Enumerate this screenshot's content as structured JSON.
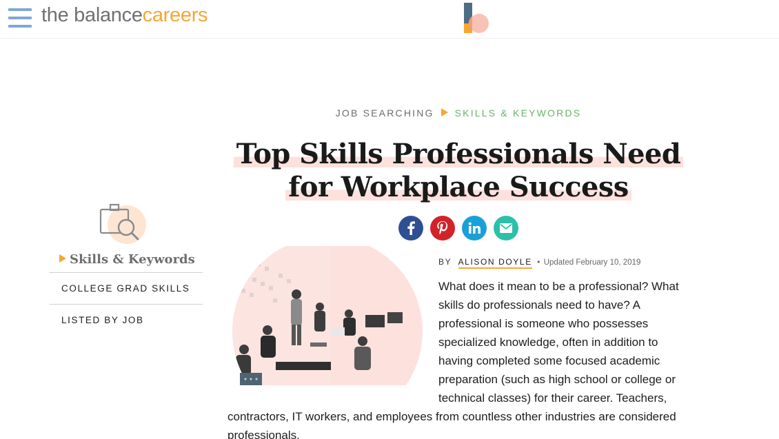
{
  "header": {
    "brand_part1": "the balance",
    "brand_part2": "careers",
    "menu_icon": "hamburger-menu-icon",
    "center_logo_icon": "balance-logo-icon"
  },
  "breadcrumb": {
    "level1": "JOB SEARCHING",
    "level2": "SKILLS & KEYWORDS"
  },
  "article": {
    "title_line1": "Top Skills Professionals Need",
    "title_line2": "for Workplace Success",
    "byline_prefix": "BY",
    "author": "ALISON DOYLE",
    "separator": "•",
    "updated": "Updated February 10, 2019",
    "paragraph_part1": "What does it mean to be a professional? What skills do professionals need to have? A professional is someone who possesses specialized knowledge, often in addition to having completed some focused academic preparation (such as high school or college or technical classes) for their career. Teachers,",
    "paragraph_part2": "contractors, IT workers, and employees from countless other industries are considered professionals."
  },
  "share": {
    "icons": [
      "facebook-icon",
      "pinterest-icon",
      "linkedin-icon",
      "email-icon"
    ]
  },
  "sidebar": {
    "icon": "briefcase-search-icon",
    "title": "Skills & Keywords",
    "items": [
      {
        "label": "COLLEGE GRAD SKILLS"
      },
      {
        "label": "LISTED BY JOB"
      }
    ]
  },
  "colors": {
    "accent_orange": "#f7a731",
    "accent_green": "#66b566",
    "menu_blue": "#7fa7d8",
    "highlight_pink": "#fde1dc"
  }
}
